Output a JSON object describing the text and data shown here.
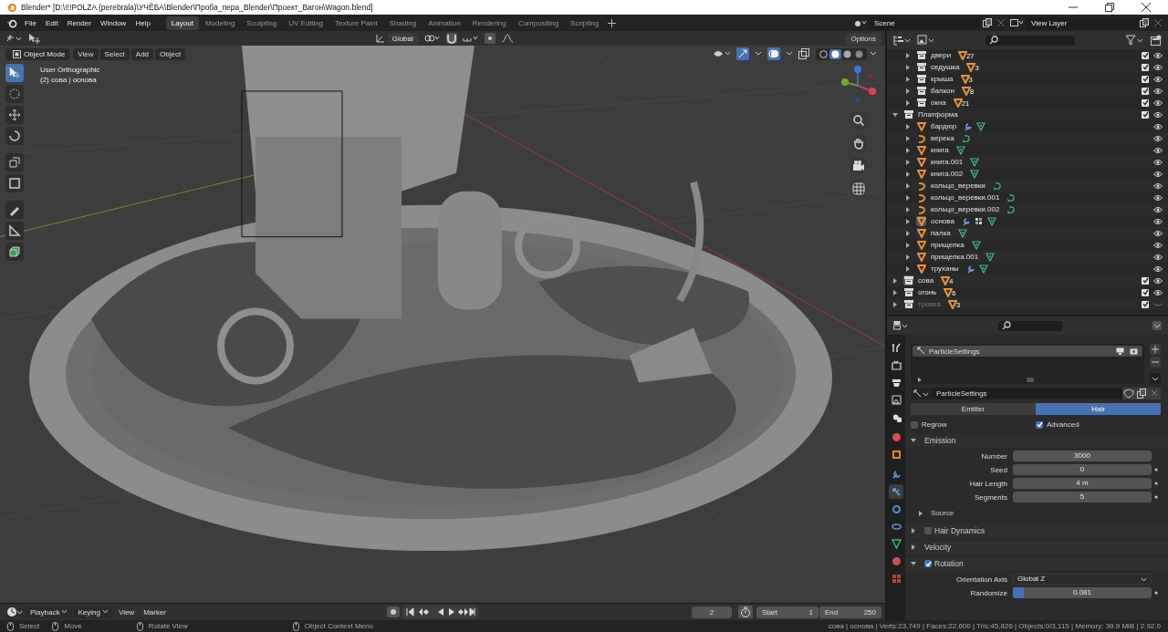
{
  "window": {
    "title": "Blender* [D:\\!!!POLZA (perebrala)\\УЧЁБА\\Blender\\Проба_пера_Blender\\Проект_Вагон\\Wagon.blend]"
  },
  "menu": [
    "File",
    "Edit",
    "Render",
    "Window",
    "Help"
  ],
  "workspaces": [
    {
      "label": "Layout",
      "selected": true
    },
    {
      "label": "Modeling",
      "selected": false
    },
    {
      "label": "Sculpting",
      "selected": false
    },
    {
      "label": "UV Editing",
      "selected": false
    },
    {
      "label": "Texture Paint",
      "selected": false
    },
    {
      "label": "Shading",
      "selected": false
    },
    {
      "label": "Animation",
      "selected": false
    },
    {
      "label": "Rendering",
      "selected": false
    },
    {
      "label": "Compositing",
      "selected": false
    },
    {
      "label": "Scripting",
      "selected": false
    }
  ],
  "scene": "Scene",
  "view_layer": "View Layer",
  "viewport": {
    "orientation": "Global",
    "options": "Options",
    "mode": "Object Mode",
    "menus": [
      "View",
      "Select",
      "Add",
      "Object"
    ],
    "view_name": "User Orthographic",
    "context": "(2) сова | основа",
    "shading_modes": [
      {
        "selected": false
      },
      {
        "selected": true
      },
      {
        "selected": false
      },
      {
        "selected": false
      }
    ],
    "tools": [
      {
        "selected": true
      },
      {
        "selected": false
      },
      {
        "selected": false
      },
      {
        "selected": false
      },
      {
        "selected": false
      },
      {
        "selected": false
      },
      {
        "selected": false
      },
      {
        "selected": false
      },
      {
        "selected": false
      }
    ]
  },
  "outliner": {
    "items": [
      {
        "kind": "group",
        "children": [
          {
            "name": "двери",
            "kind": "collection",
            "expanded": false,
            "selected": false,
            "visible": true,
            "checked": true,
            "count": "27"
          },
          {
            "name": "седушка",
            "kind": "collection",
            "expanded": false,
            "selected": false,
            "visible": true,
            "checked": true,
            "count": "3"
          },
          {
            "name": "крыша",
            "kind": "collection",
            "expanded": false,
            "selected": false,
            "visible": true,
            "checked": true,
            "count": "3"
          },
          {
            "name": "балкон",
            "kind": "collection",
            "expanded": false,
            "selected": false,
            "visible": true,
            "checked": true,
            "count": "8"
          },
          {
            "name": "окна",
            "kind": "collection",
            "expanded": false,
            "selected": false,
            "visible": true,
            "checked": true,
            "count": "21"
          }
        ]
      },
      {
        "name": "Платформа",
        "kind": "collection",
        "expanded": true,
        "selected": false,
        "visible": true,
        "checked": true,
        "children": [
          {
            "name": "бардюр",
            "kind": "mesh",
            "expanded": false,
            "selected": false,
            "visible": true,
            "data": [
              {
                "kind": "modifier"
              },
              {
                "kind": "mesh-data"
              }
            ]
          },
          {
            "name": "верека",
            "kind": "curve",
            "expanded": false,
            "selected": false,
            "visible": true,
            "data": [
              {
                "kind": "curve-data"
              }
            ]
          },
          {
            "name": "книга",
            "kind": "mesh",
            "expanded": false,
            "selected": false,
            "visible": true,
            "data": [
              {
                "kind": "mesh-data"
              }
            ]
          },
          {
            "name": "книга.001",
            "kind": "mesh",
            "expanded": false,
            "selected": false,
            "visible": true,
            "data": [
              {
                "kind": "mesh-data"
              }
            ]
          },
          {
            "name": "книга.002",
            "kind": "mesh",
            "expanded": false,
            "selected": false,
            "visible": true,
            "data": [
              {
                "kind": "mesh-data"
              }
            ]
          },
          {
            "name": "кольцо_веревки",
            "kind": "curve",
            "expanded": false,
            "selected": false,
            "visible": true,
            "data": [
              {
                "kind": "curve-data"
              }
            ]
          },
          {
            "name": "кольцо_веревки.001",
            "kind": "curve",
            "expanded": false,
            "selected": false,
            "visible": true,
            "data": [
              {
                "kind": "curve-data"
              }
            ]
          },
          {
            "name": "кольцо_веревки.002",
            "kind": "curve",
            "expanded": false,
            "selected": false,
            "visible": true,
            "data": [
              {
                "kind": "curve-data"
              }
            ]
          },
          {
            "name": "основа",
            "kind": "mesh",
            "expanded": false,
            "selected": true,
            "visible": true,
            "data": [
              {
                "kind": "modifier"
              },
              {
                "kind": "particles"
              },
              {
                "kind": "mesh-data"
              }
            ]
          },
          {
            "name": "палка",
            "kind": "mesh",
            "expanded": false,
            "selected": false,
            "visible": true,
            "data": [
              {
                "kind": "mesh-data"
              }
            ]
          },
          {
            "name": "прищепка",
            "kind": "mesh",
            "expanded": false,
            "selected": false,
            "visible": true,
            "data": [
              {
                "kind": "mesh-data"
              }
            ]
          },
          {
            "name": "прищепка.001",
            "kind": "mesh",
            "expanded": false,
            "selected": false,
            "visible": true,
            "data": [
              {
                "kind": "mesh-data"
              }
            ]
          },
          {
            "name": "труханы",
            "kind": "mesh",
            "expanded": false,
            "selected": false,
            "visible": true,
            "data": [
              {
                "kind": "modifier"
              },
              {
                "kind": "mesh-data"
              }
            ]
          }
        ]
      },
      {
        "name": "сова",
        "kind": "collection",
        "expanded": false,
        "selected": true,
        "visible": true,
        "checked": true,
        "count": "4"
      },
      {
        "name": "огонь",
        "kind": "collection",
        "expanded": false,
        "selected": false,
        "visible": true,
        "checked": true,
        "count": "6"
      },
      {
        "name": "травка",
        "kind": "collection",
        "expanded": false,
        "selected": false,
        "visible": false,
        "checked": true,
        "count": "3"
      }
    ]
  },
  "properties": {
    "tabs": [
      {
        "selected": false
      },
      {
        "selected": false
      },
      {
        "selected": false
      },
      {
        "selected": false
      },
      {
        "selected": false
      },
      {
        "selected": false
      },
      {
        "selected": false
      },
      {
        "selected": false
      },
      {
        "selected": true
      },
      {
        "selected": false
      },
      {
        "selected": false
      },
      {
        "selected": false
      },
      {
        "selected": false
      },
      {
        "selected": false
      }
    ],
    "systems": [
      {
        "name": "ParticleSettings",
        "selected": true
      }
    ],
    "settings": "ParticleSettings",
    "types": [
      {
        "label": "Emitter",
        "selected": false
      },
      {
        "label": "Hair",
        "selected": true
      }
    ],
    "options": [
      {
        "label": "Regrow",
        "checked": false
      },
      {
        "label": "Advanced",
        "checked": true
      }
    ],
    "panels": [
      {
        "title": "Emission",
        "kind": "plain",
        "expanded": true,
        "fields": [
          {
            "label": "Number",
            "value": "3000",
            "kind": "number",
            "animatable": false
          },
          {
            "label": "Seed",
            "value": "0",
            "kind": "number",
            "animatable": true
          },
          {
            "label": "Hair Length",
            "value": "4 m",
            "kind": "number",
            "animatable": true
          },
          {
            "label": "Segments",
            "value": "5",
            "kind": "number",
            "animatable": true
          }
        ],
        "subpanels": [
          {
            "title": "Source",
            "expanded": false
          }
        ]
      },
      {
        "title": "Hair Dynamics",
        "kind": "toggle",
        "checked": false,
        "expanded": false
      },
      {
        "title": "Velocity",
        "kind": "plain",
        "expanded": false
      },
      {
        "title": "Rotation",
        "kind": "toggle",
        "checked": true,
        "expanded": true,
        "fields": [
          {
            "label": "Orientation Axis",
            "value": "Global Z",
            "kind": "dropdown",
            "animatable": false
          },
          {
            "label": "Randomize",
            "value": "0.081",
            "kind": "slider",
            "level": 0.081,
            "animatable": true
          }
        ]
      }
    ]
  },
  "timeline": {
    "menus": [
      {
        "label": "Playback",
        "dropdown": true
      },
      {
        "label": "Keying",
        "dropdown": true
      },
      {
        "label": "View",
        "dropdown": false
      },
      {
        "label": "Marker",
        "dropdown": false
      }
    ],
    "frame": "2",
    "start_label": "Start",
    "start": "1",
    "end_label": "End",
    "end": "250"
  },
  "status": {
    "hints": [
      "Select",
      "Move",
      "Rotate View",
      "Object Context Menu"
    ],
    "stats": "сова | основа | Verts:23,749 | Faces:22,600 | Tris:45,826 | Objects:0/3,115 | Memory: 39.9 MiB | 2.92.0"
  }
}
